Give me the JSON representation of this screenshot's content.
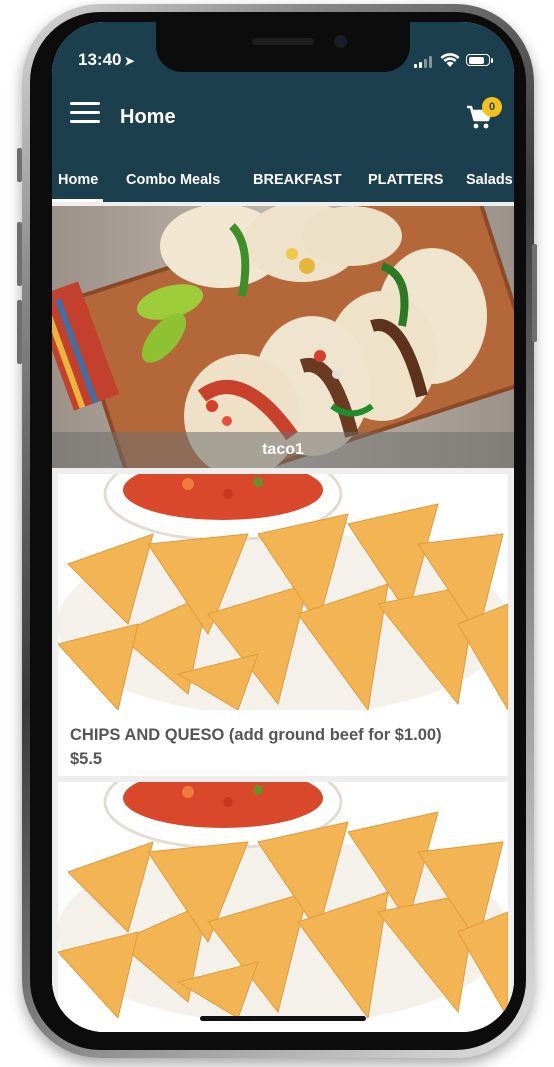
{
  "status_bar": {
    "time": "13:40",
    "location_icon": "location-arrow-icon",
    "signal_icon": "cellular-signal-icon",
    "wifi_icon": "wifi-icon",
    "battery_icon": "battery-icon"
  },
  "app_bar": {
    "menu_icon": "hamburger-menu-icon",
    "title": "Home",
    "cart_icon": "shopping-cart-icon",
    "cart_count": "0"
  },
  "tabs": [
    {
      "label": "Home",
      "active": true
    },
    {
      "label": "Combo Meals",
      "active": false
    },
    {
      "label": "BREAKFAST",
      "active": false
    },
    {
      "label": "PLATTERS",
      "active": false
    },
    {
      "label": "Salads",
      "active": false
    }
  ],
  "hero": {
    "caption": "taco1"
  },
  "items": [
    {
      "title": "CHIPS AND QUESO (add ground beef for $1.00)",
      "price": "$5.5"
    },
    {
      "title": "",
      "price": ""
    }
  ],
  "colors": {
    "header": "#1b3f4d",
    "badge": "#f5c11d",
    "content_bg": "#eeeeee",
    "card_text": "#555555"
  }
}
